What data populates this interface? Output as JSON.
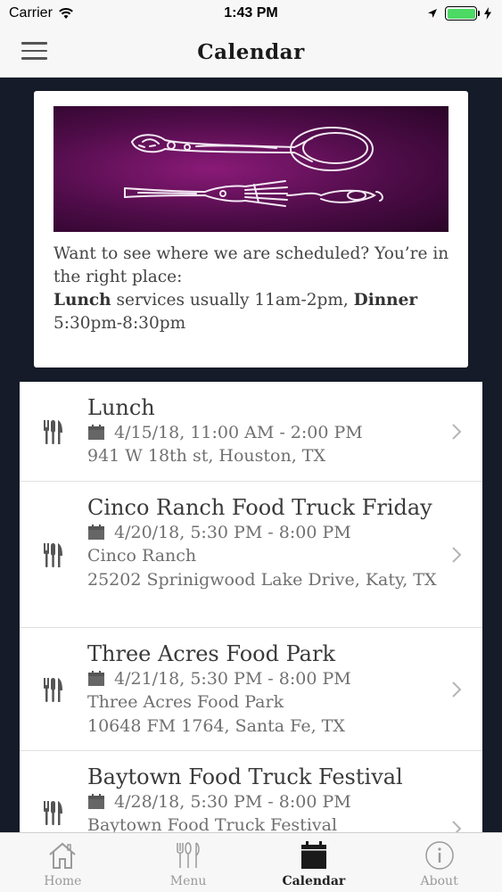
{
  "status": {
    "carrier": "Carrier",
    "time": "1:43 PM"
  },
  "nav": {
    "title": "Calendar"
  },
  "info": {
    "text1": "Want to see where we are scheduled? You’re in the right place:",
    "lunch_label": "Lunch",
    "lunch_text": " services usually 11am-2pm, ",
    "dinner_label": "Dinner",
    "dinner_text": " 5:30pm-8:30pm"
  },
  "events": [
    {
      "title": "Lunch",
      "date": "4/15/18, 11:00 AM - 2:00 PM",
      "lines": [
        "941 W 18th st, Houston, TX"
      ]
    },
    {
      "title": "Cinco Ranch Food Truck Friday",
      "date": "4/20/18, 5:30 PM - 8:00 PM",
      "lines": [
        "Cinco Ranch",
        "25202 Sprinigwood Lake Drive, Katy, TX"
      ]
    },
    {
      "title": "Three Acres Food Park",
      "date": "4/21/18, 5:30 PM - 8:00 PM",
      "lines": [
        "Three Acres Food Park",
        "10648 FM 1764, Santa Fe, TX"
      ]
    },
    {
      "title": "Baytown Food Truck Festival",
      "date": "4/28/18, 5:30 PM - 8:00 PM",
      "lines": [
        "Baytown Food Truck Festival"
      ]
    }
  ],
  "tabs": [
    {
      "label": "Home",
      "icon": "home-icon"
    },
    {
      "label": "Menu",
      "icon": "utensils-icon"
    },
    {
      "label": "Calendar",
      "icon": "calendar-icon",
      "active": true
    },
    {
      "label": "About",
      "icon": "info-icon"
    }
  ],
  "colors": {
    "page_bg": "#151b28",
    "banner_purple": "#5e0f58",
    "battery_green": "#4cd964"
  }
}
